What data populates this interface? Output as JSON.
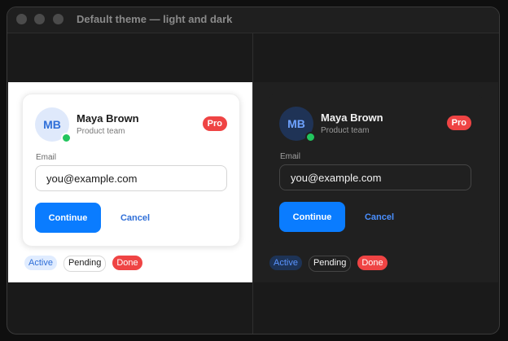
{
  "window": {
    "title": "Default theme — light and dark"
  },
  "profile": {
    "initials": "MB",
    "name": "Maya Brown",
    "team": "Product team",
    "badge": "Pro"
  },
  "form": {
    "email_label": "Email",
    "email_value": "you@example.com",
    "continue_label": "Continue",
    "cancel_label": "Cancel"
  },
  "chips": {
    "active": "Active",
    "pending": "Pending",
    "done": "Done"
  },
  "colors": {
    "accent": "#0a7cff",
    "danger": "#ef4444",
    "presence": "#22c55e"
  }
}
